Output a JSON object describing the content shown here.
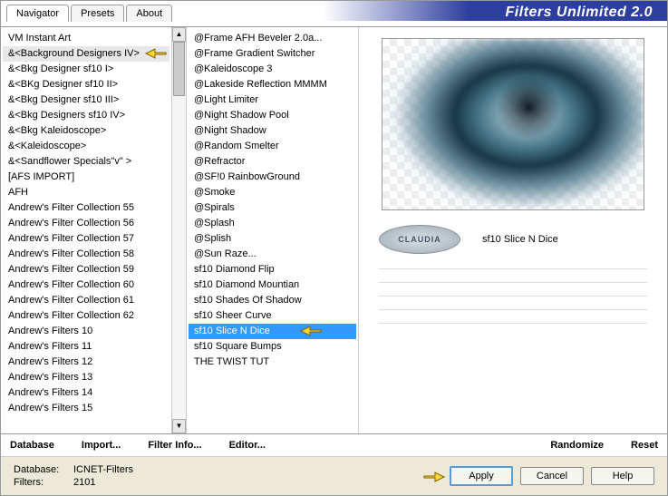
{
  "title": "Filters Unlimited 2.0",
  "tabs": [
    {
      "label": "Navigator",
      "active": true
    },
    {
      "label": "Presets",
      "active": false
    },
    {
      "label": "About",
      "active": false
    }
  ],
  "categories": [
    "VM Instant Art",
    "&<Background Designers IV>",
    "&<Bkg Designer sf10 I>",
    "&<BKg Designer sf10 II>",
    "&<Bkg Designer sf10 III>",
    "&<Bkg Designers sf10 IV>",
    "&<Bkg Kaleidoscope>",
    "&<Kaleidoscope>",
    "&<Sandflower Specials\"v\" >",
    "[AFS IMPORT]",
    "AFH",
    "Andrew's Filter Collection 55",
    "Andrew's Filter Collection 56",
    "Andrew's Filter Collection 57",
    "Andrew's Filter Collection 58",
    "Andrew's Filter Collection 59",
    "Andrew's Filter Collection 60",
    "Andrew's Filter Collection 61",
    "Andrew's Filter Collection 62",
    "Andrew's Filters 10",
    "Andrew's Filters 11",
    "Andrew's Filters 12",
    "Andrew's Filters 13",
    "Andrew's Filters 14",
    "Andrew's Filters 15"
  ],
  "selected_category_index": 1,
  "filters": [
    "@Frame AFH Beveler 2.0a...",
    "@Frame Gradient Switcher",
    "@Kaleidoscope 3",
    "@Lakeside Reflection MMMM",
    "@Light Limiter",
    "@Night Shadow Pool",
    "@Night Shadow",
    "@Random Smelter",
    "@Refractor",
    "@SF!0 RainbowGround",
    "@Smoke",
    "@Spirals",
    "@Splash",
    "@Splish",
    "@Sun Raze...",
    "sf10 Diamond Flip",
    "sf10 Diamond Mountian",
    "sf10 Shades Of Shadow",
    "sf10 Sheer Curve",
    "sf10 Slice N Dice",
    "sf10 Square Bumps",
    "THE TWIST TUT"
  ],
  "selected_filter_index": 19,
  "current_filter_name": "sf10 Slice N Dice",
  "badge_text": "CLAUDIA",
  "toolbar": {
    "database": "Database",
    "import": "Import...",
    "filter_info": "Filter Info...",
    "editor": "Editor...",
    "randomize": "Randomize",
    "reset": "Reset"
  },
  "footer": {
    "database_label": "Database:",
    "database_value": "ICNET-Filters",
    "filters_label": "Filters:",
    "filters_value": "2101",
    "apply": "Apply",
    "cancel": "Cancel",
    "help": "Help"
  }
}
